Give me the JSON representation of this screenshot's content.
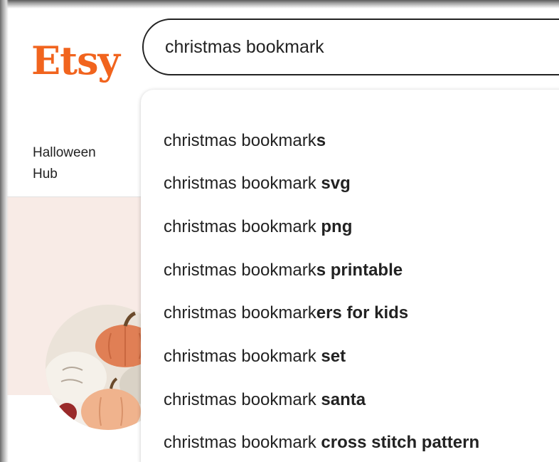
{
  "brand": {
    "logo_text": "Etsy",
    "logo_color": "#f1641e"
  },
  "search": {
    "value": "christmas bookmark"
  },
  "nav": {
    "halloween_line1": "Halloween",
    "halloween_line2": "Hub"
  },
  "hero": {
    "background_color": "#f8ebe6",
    "image": "pumpkins-photo"
  },
  "suggestions": [
    {
      "prefix": "christmas bookmark",
      "suffix": "s"
    },
    {
      "prefix": "christmas bookmark ",
      "suffix": "svg"
    },
    {
      "prefix": "christmas bookmark ",
      "suffix": "png"
    },
    {
      "prefix": "christmas bookmark",
      "suffix": "s printable"
    },
    {
      "prefix": "christmas bookmark",
      "suffix": "ers for kids"
    },
    {
      "prefix": "christmas bookmark ",
      "suffix": "set"
    },
    {
      "prefix": "christmas bookmark ",
      "suffix": "santa"
    },
    {
      "prefix": "christmas bookmark ",
      "suffix": "cross stitch pattern"
    }
  ]
}
